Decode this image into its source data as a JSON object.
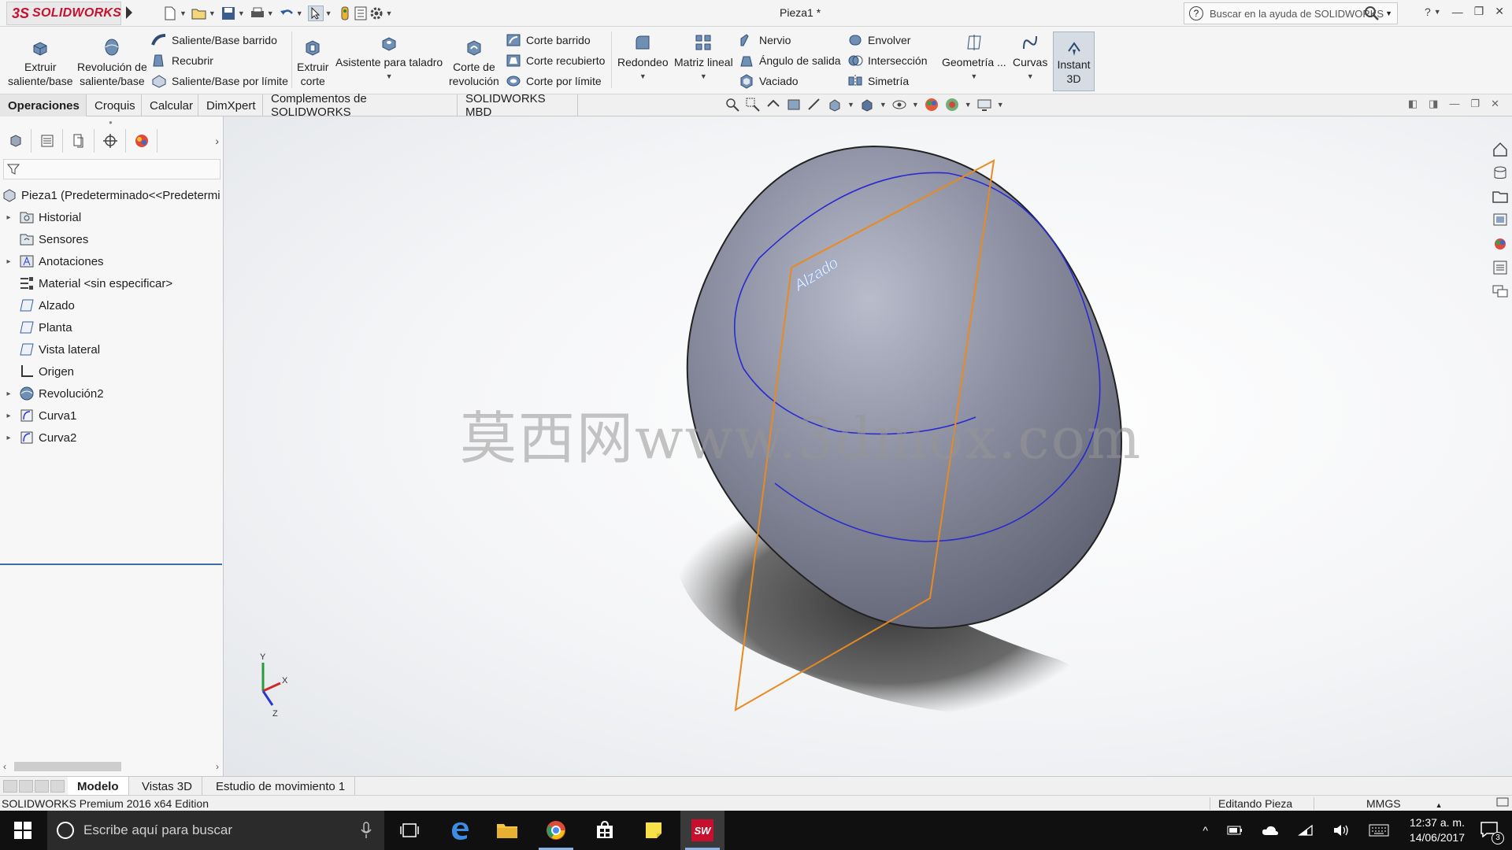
{
  "app": {
    "brand_ds": "3S",
    "brand_name": "SOLIDWORKS",
    "document_title": "Pieza1 *",
    "help_search_placeholder": "Buscar en la ayuda de SOLIDWORKS"
  },
  "ribbon": {
    "extruir": [
      "Extruir",
      "saliente/base"
    ],
    "revolucion": [
      "Revolución de",
      "saliente/base"
    ],
    "saliente_barrido": "Saliente/Base barrido",
    "recubrir": "Recubrir",
    "saliente_limite": "Saliente/Base por límite",
    "extruir_corte": [
      "Extruir",
      "corte"
    ],
    "asistente": "Asistente para taladro",
    "corte_revolucion": [
      "Corte de",
      "revolución"
    ],
    "corte_barrido": "Corte barrido",
    "corte_recubierto": "Corte recubierto",
    "corte_limite": "Corte por límite",
    "redondeo": "Redondeo",
    "matriz": "Matriz lineal",
    "nervio": "Nervio",
    "angulo": "Ángulo de salida",
    "vaciado": "Vaciado",
    "envolver": "Envolver",
    "interseccion": "Intersección",
    "simetria": "Simetría",
    "geometria": "Geometría ...",
    "curvas": "Curvas",
    "instant3d": [
      "Instant",
      "3D"
    ]
  },
  "command_tabs": [
    "Operaciones",
    "Croquis",
    "Calcular",
    "DimXpert",
    "Complementos de SOLIDWORKS",
    "SOLIDWORKS MBD"
  ],
  "tree": {
    "root": "Pieza1  (Predeterminado<<Predetermi",
    "items": [
      {
        "label": "Historial",
        "expandable": true,
        "icon": "history-folder-icon"
      },
      {
        "label": "Sensores",
        "expandable": false,
        "icon": "sensors-folder-icon"
      },
      {
        "label": "Anotaciones",
        "expandable": true,
        "icon": "annotations-icon"
      },
      {
        "label": "Material <sin especificar>",
        "expandable": false,
        "icon": "material-icon"
      },
      {
        "label": "Alzado",
        "expandable": false,
        "icon": "plane-icon"
      },
      {
        "label": "Planta",
        "expandable": false,
        "icon": "plane-icon"
      },
      {
        "label": "Vista lateral",
        "expandable": false,
        "icon": "plane-icon"
      },
      {
        "label": "Origen",
        "expandable": false,
        "icon": "origin-icon"
      },
      {
        "label": "Revolución2",
        "expandable": true,
        "icon": "revolve-feature-icon"
      },
      {
        "label": "Curva1",
        "expandable": true,
        "icon": "curve-icon"
      },
      {
        "label": "Curva2",
        "expandable": true,
        "icon": "curve-icon"
      }
    ]
  },
  "viewport": {
    "plane_label": "Alzado",
    "watermark": "莫西网www.3dmox.com",
    "triad_axes": [
      "Y",
      "X",
      "Z"
    ]
  },
  "bottom_tabs": [
    "Modelo",
    "Vistas 3D",
    "Estudio de movimiento 1"
  ],
  "status": {
    "edition": "SOLIDWORKS Premium 2016 x64 Edition",
    "mode": "Editando Pieza",
    "units": "MMGS"
  },
  "taskbar": {
    "search_placeholder": "Escribe aquí para buscar",
    "time": "12:37 a. m.",
    "date": "14/06/2017",
    "notifications": "3",
    "sw_app_label": "SW"
  },
  "colors": {
    "brand_red": "#c8102e",
    "sketch_blue": "#2a2ad0",
    "plane_orange": "#e88a20",
    "model_gray": "#7c7f8e"
  }
}
